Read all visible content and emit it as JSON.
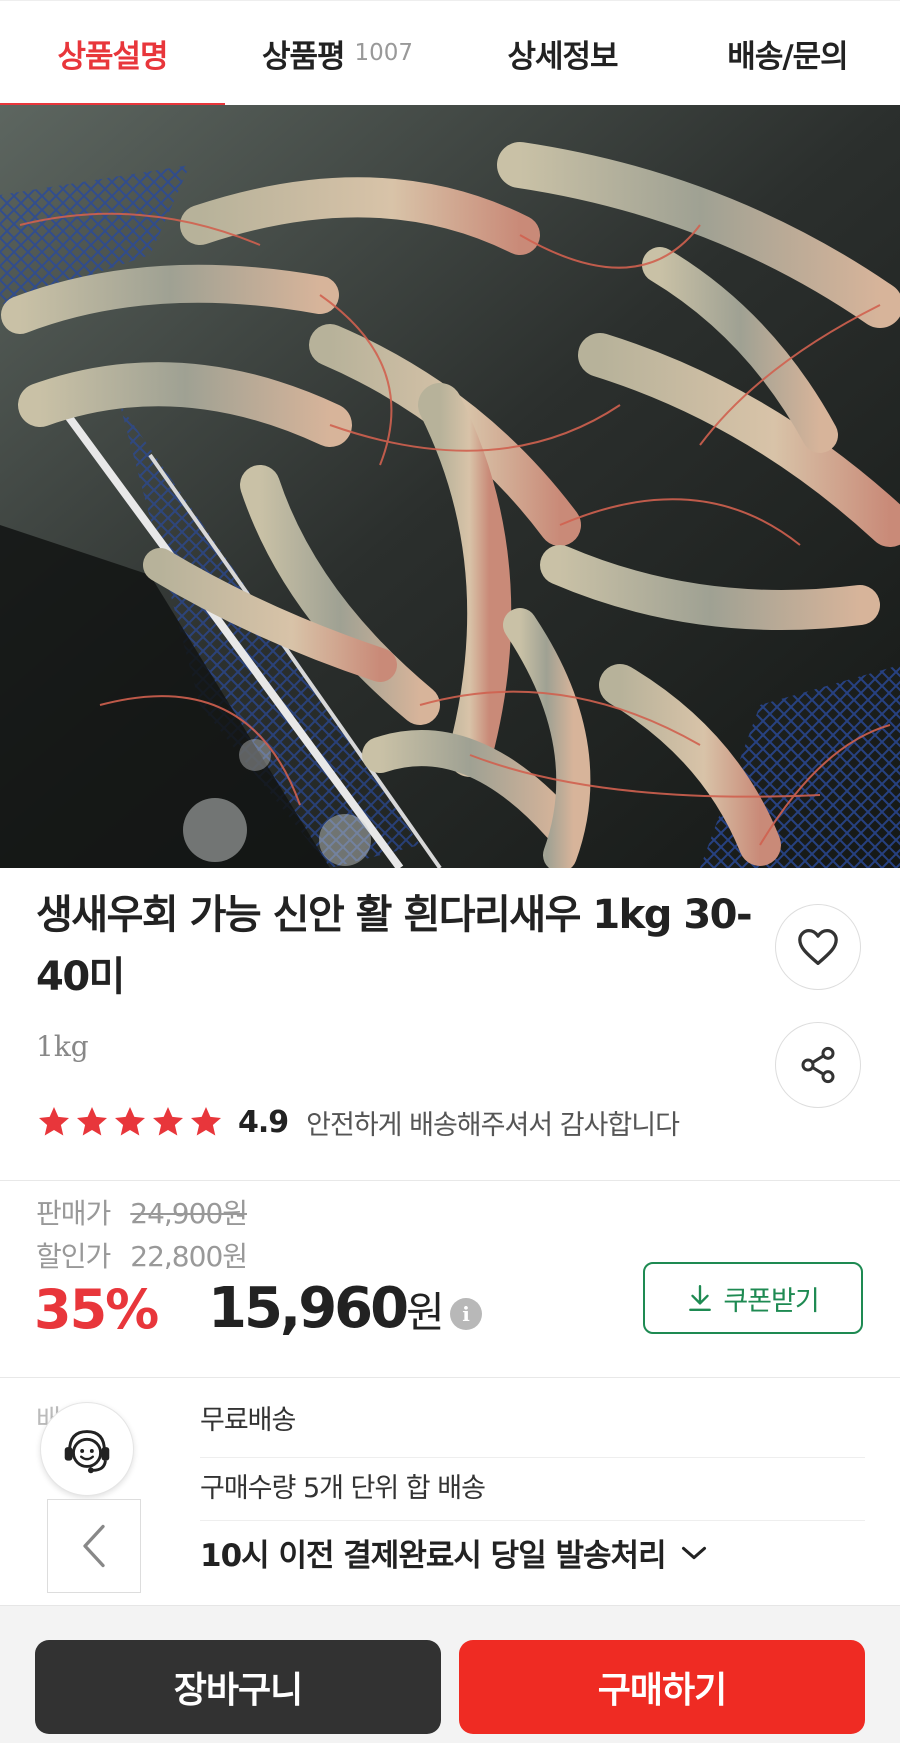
{
  "tabs": [
    {
      "label": "상품설명",
      "count": ""
    },
    {
      "label": "상품평",
      "count": "1007"
    },
    {
      "label": "상세정보",
      "count": ""
    },
    {
      "label": "배송/문의",
      "count": ""
    }
  ],
  "product": {
    "title": "생새우회 가능 신안 활 흰다리새우 1kg 30-40미",
    "option": "1kg",
    "rating": "4.9",
    "stars": 5,
    "review_snippet": "안전하게 배송해주셔서 감사합니다"
  },
  "price": {
    "sale_label": "판매가",
    "sale_value": "24,900원",
    "discount_label": "할인가",
    "discount_value": "22,800원",
    "rate": "35%",
    "final": "15,960",
    "final_unit": "원",
    "info_icon": "i",
    "coupon_label": "쿠폰받기"
  },
  "shipping": {
    "label": "배송",
    "line1": "무료배송",
    "line2": "구매수량 5개 단위 합 배송",
    "line3": "10시 이전 결제완료시 당일 발송처리"
  },
  "bottom": {
    "cart_label": "장바구니",
    "buy_label": "구매하기"
  },
  "colors": {
    "accent": "#e8363b",
    "coupon": "#1e8a52",
    "buy": "#ef2b23",
    "cart": "#323232"
  }
}
